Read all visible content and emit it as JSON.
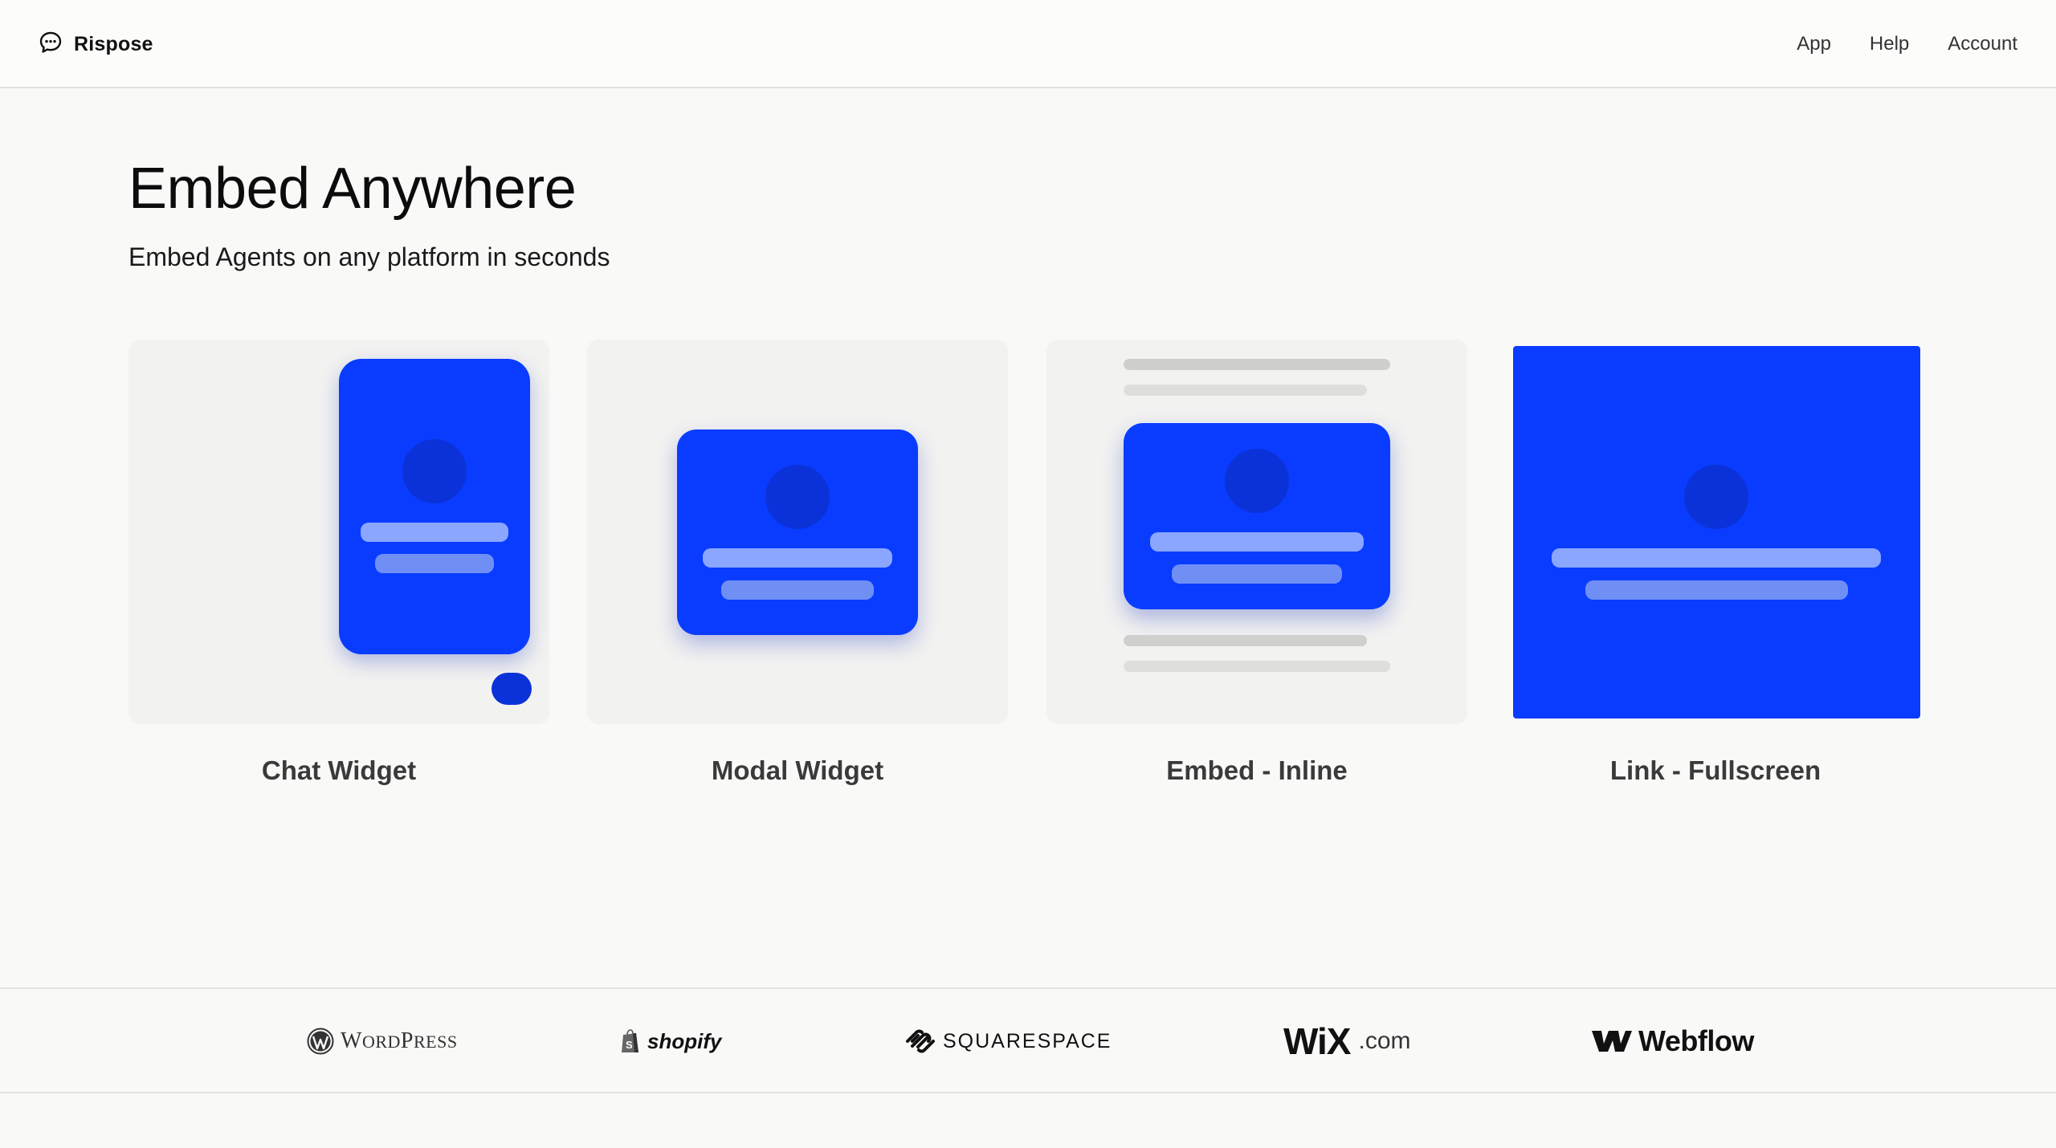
{
  "header": {
    "brand": "Rispose",
    "nav": [
      "App",
      "Help",
      "Account"
    ]
  },
  "hero": {
    "title": "Embed Anywhere",
    "subtitle": "Embed Agents on any platform in seconds"
  },
  "cards": [
    {
      "label": "Chat Widget",
      "icon": "chat-widget-illustration"
    },
    {
      "label": "Modal Widget",
      "icon": "modal-widget-illustration"
    },
    {
      "label": "Embed - Inline",
      "icon": "inline-embed-illustration"
    },
    {
      "label": "Link - Fullscreen",
      "icon": "fullscreen-link-illustration"
    }
  ],
  "platforms": {
    "wordpress": {
      "first": "W",
      "rest1": "ORD",
      "second": "P",
      "rest2": "RESS"
    },
    "shopify": "shopify",
    "squarespace": "SQUARESPACE",
    "wix": {
      "main": "WiX",
      "suffix": ".com"
    },
    "webflow": "Webflow"
  },
  "colors": {
    "accent_blue": "#0a3cff",
    "accent_blue_dark": "#0b32d8",
    "card_bg": "#f2f2f1",
    "page_bg": "#f9f9f8"
  }
}
